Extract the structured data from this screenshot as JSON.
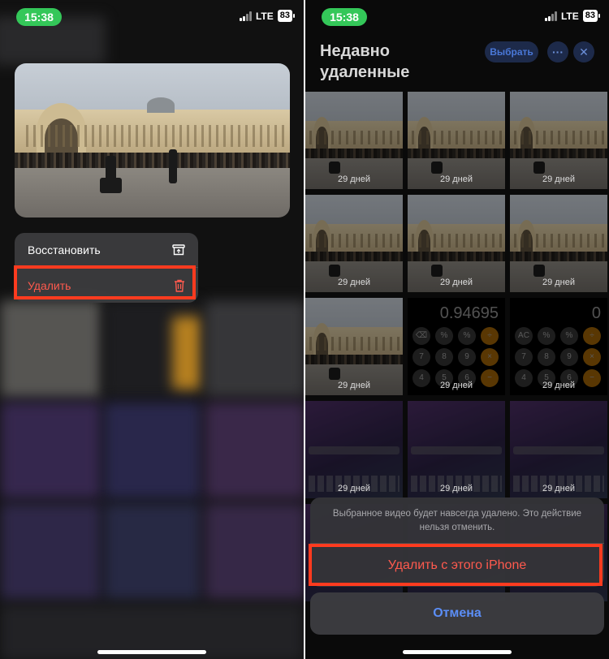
{
  "status_bar": {
    "time": "15:38",
    "network": "LTE",
    "battery": "83"
  },
  "left_panel": {
    "context_menu": {
      "restore_label": "Восстановить",
      "delete_label": "Удалить"
    }
  },
  "right_panel": {
    "title_line1": "Недавно",
    "title_line2": "удаленные",
    "select_button": "Выбрать",
    "more_icon": "ellipsis-icon",
    "close_icon": "close-icon",
    "grid_days_label": "29 дней",
    "calculator_values": [
      "0.94695",
      "0"
    ],
    "action_sheet": {
      "message": "Выбранное видео будет навсегда удалено. Это действие нельзя отменить.",
      "delete_button": "Удалить с этого iPhone",
      "cancel_button": "Отмена"
    }
  },
  "colors": {
    "status_time_pill": "#34c759",
    "destructive": "#ff5a4e",
    "highlight_box": "#ff3b1f",
    "accent_blue": "#5b8ef7"
  }
}
